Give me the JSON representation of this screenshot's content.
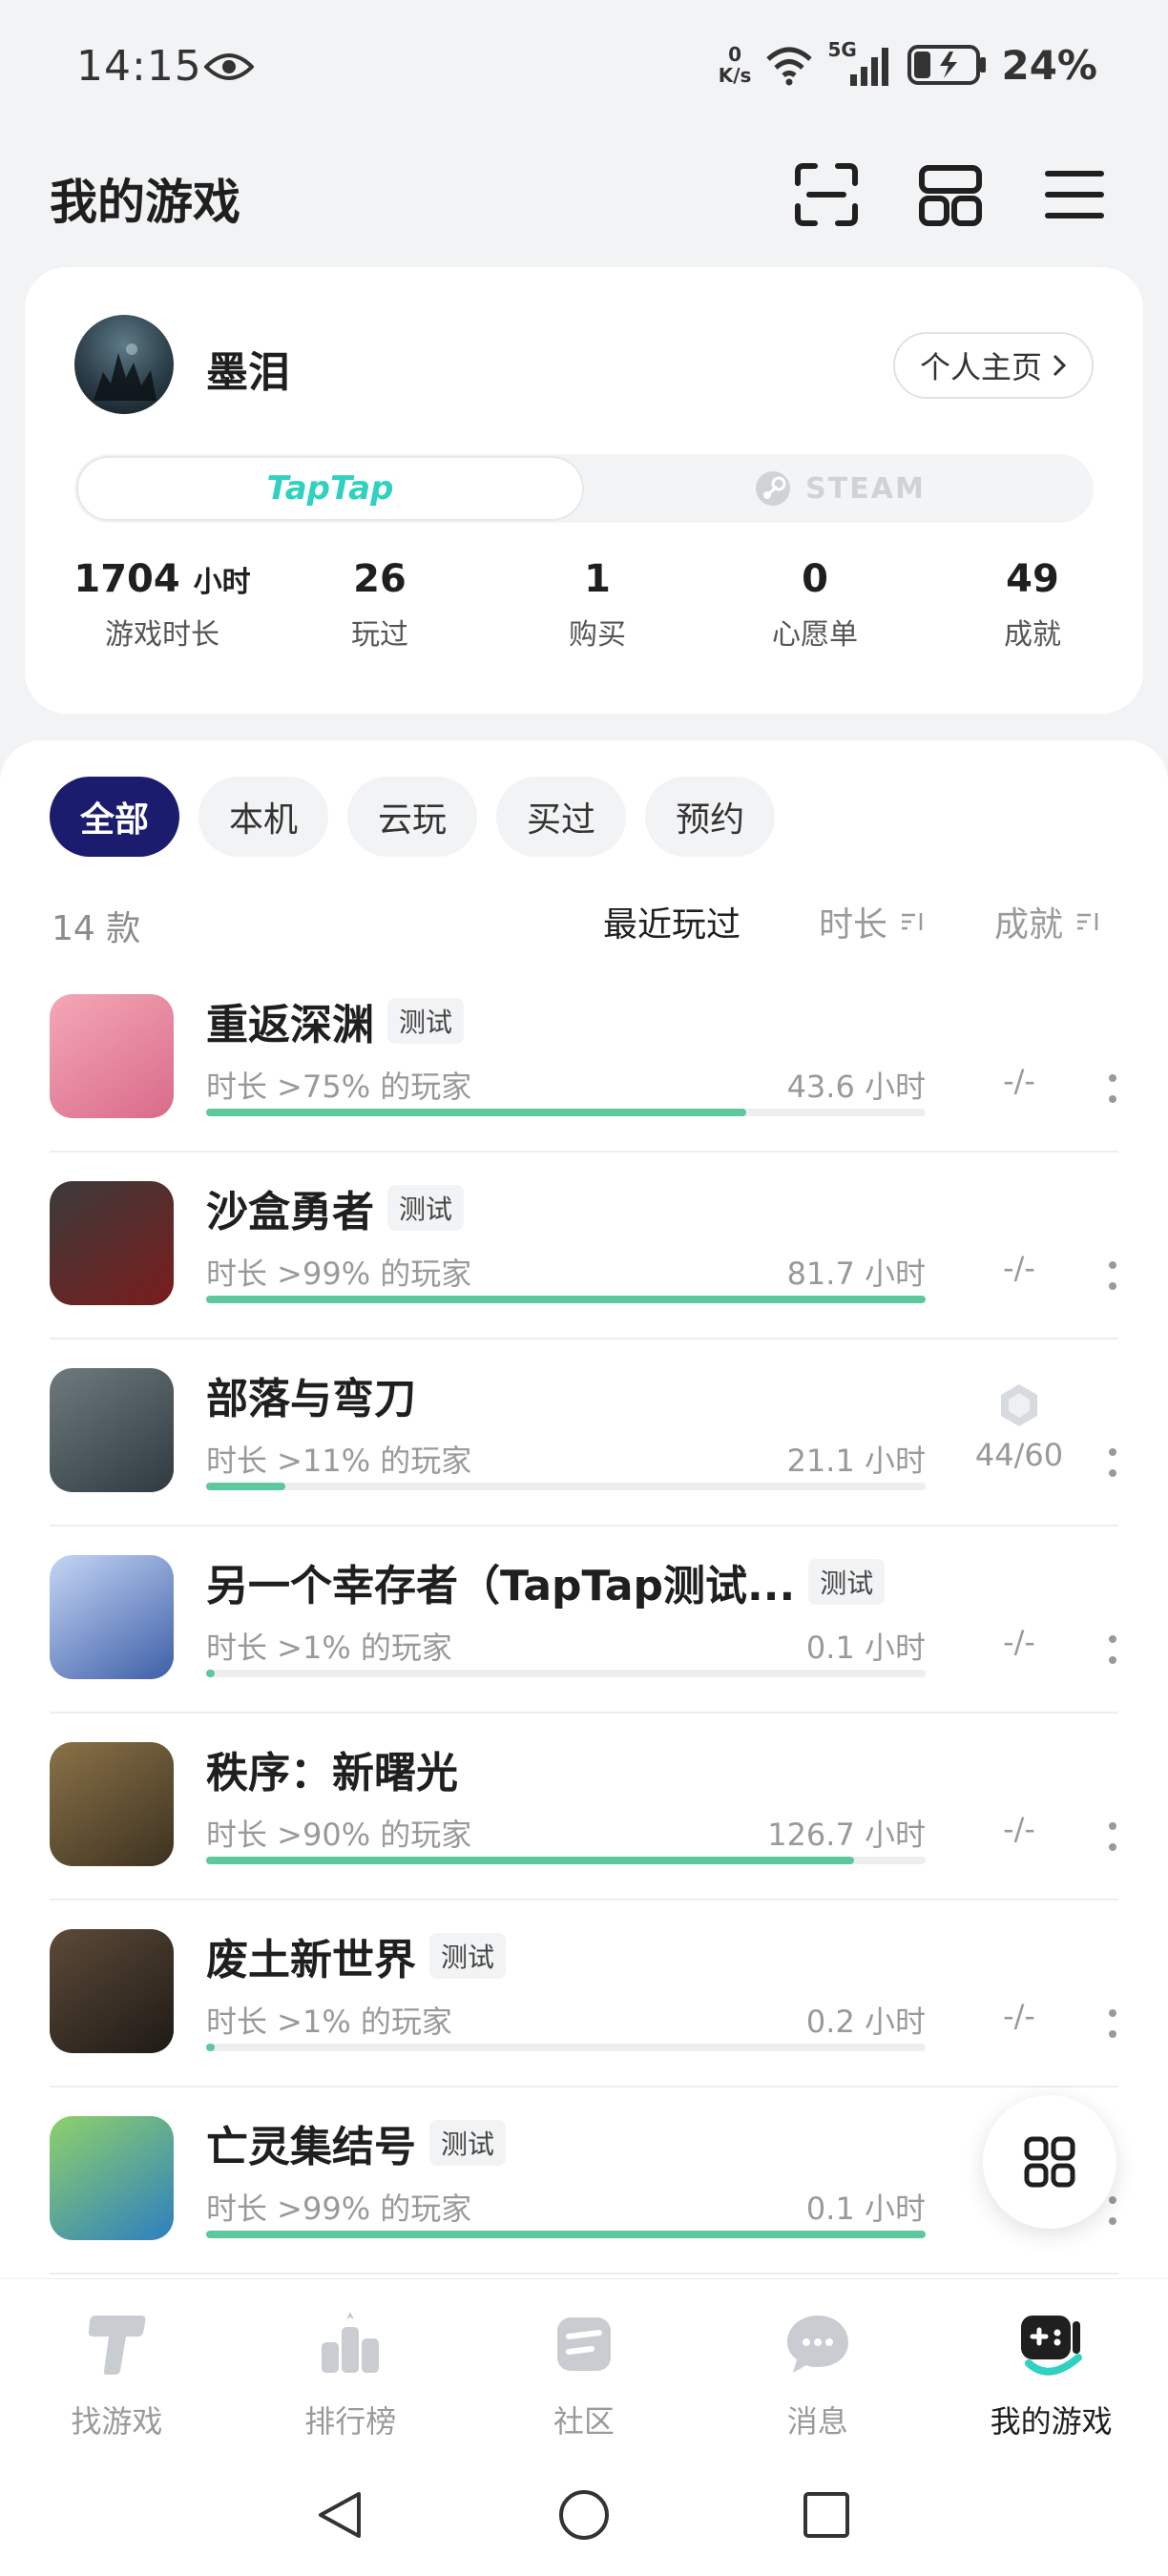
{
  "status_bar": {
    "time": "14:15",
    "net_speed_value": "0",
    "net_speed_unit": "K/s",
    "signal": "5G",
    "battery": "24%"
  },
  "header": {
    "title": "我的游戏"
  },
  "profile": {
    "username": "墨泪",
    "homepage_label": "个人主页",
    "platforms": {
      "taptap": "TapTap",
      "steam": "STEAM"
    },
    "stats": [
      {
        "value": "1704",
        "unit": "小时",
        "label": "游戏时长"
      },
      {
        "value": "26",
        "label": "玩过"
      },
      {
        "value": "1",
        "label": "购买"
      },
      {
        "value": "0",
        "label": "心愿单"
      },
      {
        "value": "49",
        "label": "成就"
      }
    ]
  },
  "filters": [
    "全部",
    "本机",
    "云玩",
    "买过",
    "预约"
  ],
  "list_header": {
    "count": "14 款",
    "sort_recent": "最近玩过",
    "sort_time": "时长",
    "sort_achievements": "成就"
  },
  "games": [
    {
      "title": "重返深渊",
      "badge": "测试",
      "percentile": "时长 >75% 的玩家",
      "hours": "43.6 小时",
      "progress": 0.75,
      "achievements": "-/-",
      "icon_colors": [
        "#f4a7b6",
        "#d96b8a"
      ]
    },
    {
      "title": "沙盒勇者",
      "badge": "测试",
      "percentile": "时长 >99% 的玩家",
      "hours": "81.7 小时",
      "progress": 1.0,
      "achievements": "-/-",
      "icon_colors": [
        "#3b3b3b",
        "#7a1c1c"
      ]
    },
    {
      "title": "部落与弯刀",
      "badge": "",
      "percentile": "时长 >11% 的玩家",
      "hours": "21.1 小时",
      "progress": 0.11,
      "achievements": "44/60",
      "icon_colors": [
        "#6f7a7e",
        "#2f3a40"
      ]
    },
    {
      "title": "另一个幸存者（TapTap测试...",
      "badge": "测试",
      "percentile": "时长 >1% 的玩家",
      "hours": "0.1 小时",
      "progress": 0.01,
      "achievements": "-/-",
      "icon_colors": [
        "#c4d6f5",
        "#3e5fa8"
      ]
    },
    {
      "title": "秩序：新曙光",
      "badge": "",
      "percentile": "时长 >90% 的玩家",
      "hours": "126.7 小时",
      "progress": 0.9,
      "achievements": "-/-",
      "icon_colors": [
        "#8a7248",
        "#3d3220"
      ]
    },
    {
      "title": "废土新世界",
      "badge": "测试",
      "percentile": "时长 >1% 的玩家",
      "hours": "0.2 小时",
      "progress": 0.01,
      "achievements": "-/-",
      "icon_colors": [
        "#5d4a38",
        "#1e1a16"
      ]
    },
    {
      "title": "亡灵集结号",
      "badge": "测试",
      "percentile": "时长 >99% 的玩家",
      "hours": "0.1 小时",
      "progress": 1.0,
      "achievements": "",
      "icon_colors": [
        "#8fd16a",
        "#2d7fc0"
      ]
    }
  ],
  "bottom_nav": [
    {
      "label": "找游戏",
      "icon": "taptap-icon"
    },
    {
      "label": "排行榜",
      "icon": "ranking-icon"
    },
    {
      "label": "社区",
      "icon": "community-icon"
    },
    {
      "label": "消息",
      "icon": "message-icon"
    },
    {
      "label": "我的游戏",
      "icon": "my-games-icon",
      "active": true
    }
  ],
  "colors": {
    "accent_navy": "#1c1c6e",
    "progress_green": "#5dc79e",
    "taptap_teal": "#2fd1c0"
  }
}
